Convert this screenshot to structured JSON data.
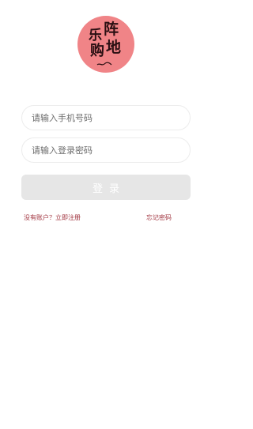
{
  "logo": {
    "chars": [
      "乐",
      "阵",
      "购",
      "地"
    ],
    "color": "#f08487"
  },
  "login_form": {
    "phone_placeholder": "请输入手机号码",
    "password_placeholder": "请输入登录密码",
    "login_label": "登录"
  },
  "links": {
    "register": "没有账户？立即注册",
    "forgot_password": "忘记密码"
  },
  "colors": {
    "accent": "#a1343f",
    "button_disabled": "#e6e6e6"
  }
}
